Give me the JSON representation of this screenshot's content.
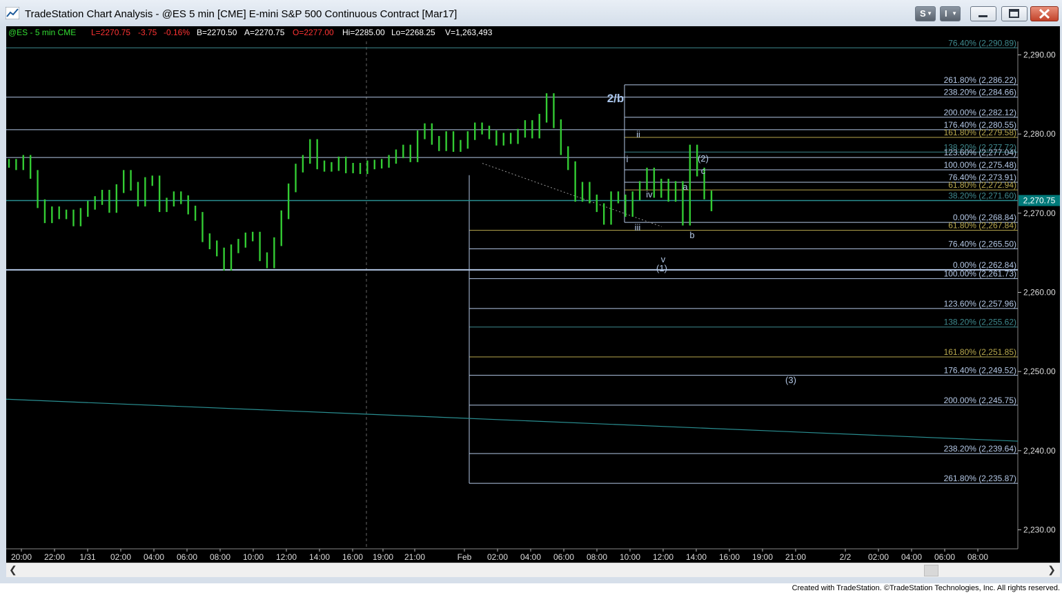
{
  "window": {
    "title": "TradeStation Chart Analysis - @ES 5 min [CME] E-mini S&P 500 Continuous Contract [Mar17]",
    "btn_s": "S",
    "btn_i": "I",
    "footer": "Created with TradeStation. ©TradeStation Technologies, Inc. All rights reserved."
  },
  "colors": {
    "background": "#000000",
    "bars": "#33cc33",
    "fib": "#b4c8e6",
    "fib_gold": "#b9a94e",
    "fib_teal": "#3f8a8f",
    "trend": "#2a8f92",
    "price_label_bg": "#007a7a"
  },
  "quote": {
    "symbol": "@ES - 5 min  CME",
    "last": "L=2270.75",
    "change": "-3.75",
    "pct": "-0.16%",
    "bid": "B=2270.50",
    "ask": "A=2270.75",
    "open": "O=2277.00",
    "high": "Hi=2285.00",
    "low": "Lo=2268.25",
    "volume": "V=1,263,493"
  },
  "chart_data": {
    "type": "line",
    "title": "@ES 5 min [CME] E-mini S&P 500 Continuous Contract [Mar17]",
    "series": [
      {
        "values": [
          2276.3,
          2276.0,
          2276.8,
          2274.9,
          2271.2,
          2269.3,
          2270.3,
          2269.8,
          2269.9,
          2268.9,
          2270.1,
          2271.0,
          2271.6,
          2272.4,
          2270.6,
          2273.1,
          2274.9,
          2273.4,
          2271.4,
          2274.0,
          2274.2,
          2270.7,
          2271.4,
          2272.2,
          2271.7,
          2270.4,
          2269.6,
          2266.9,
          2266.0,
          2265.1,
          2263.3,
          2265.5,
          2266.2,
          2267.0,
          2267.1,
          2264.5,
          2263.6,
          2266.4,
          2269.8,
          2273.2,
          2275.7,
          2276.8,
          2278.8,
          2276.1,
          2275.8,
          2275.9,
          2276.6,
          2275.6,
          2275.8,
          2275.5,
          2276.1,
          2276.2,
          2276.3,
          2276.8,
          2277.5,
          2278.1,
          2277.0,
          2279.9,
          2280.8,
          2279.2,
          2278.4,
          2279.8,
          2278.3,
          2278.7,
          2279.8,
          2280.9,
          2280.5,
          2279.9,
          2279.1,
          2279.6,
          2279.3,
          2280.1,
          2281.2,
          2280.0,
          2282.0,
          2284.6,
          2281.3,
          2277.9,
          2276.0,
          2272.0,
          2273.4,
          2271.8,
          2270.7,
          2269.1,
          2272.2,
          2271.8,
          2270.1,
          2272.2,
          2273.5,
          2275.2,
          2272.5,
          2273.8,
          2272.0,
          2273.5,
          2269.0,
          2278.1,
          2275.2,
          2272.3,
          2270.8
        ]
      }
    ],
    "x_ticks": [
      "20:00",
      "22:00",
      "1/31",
      "02:00",
      "04:00",
      "06:00",
      "08:00",
      "10:00",
      "12:00",
      "14:00",
      "16:00",
      "19:00",
      "21:00",
      "Feb",
      "02:00",
      "04:00",
      "06:00",
      "08:00",
      "10:00",
      "12:00",
      "14:00",
      "16:00",
      "19:00",
      "21:00",
      "2/2",
      "02:00",
      "04:00",
      "06:00",
      "08:00"
    ],
    "y_ticks": [
      "2,290.00",
      "2,280.00",
      "2,270.00",
      "2,260.00",
      "2,250.00",
      "2,240.00",
      "2,230.00"
    ],
    "ylim": [
      2227.6,
      2291.7
    ],
    "last_price": "2,270.75",
    "wave_labels": [
      "2/b",
      "ii",
      "i",
      "iv",
      "iii",
      "v",
      "(1)",
      "a",
      "b",
      "c",
      "(2)",
      "(3)"
    ],
    "fib_right": [
      {
        "label": "76.40% (2,290.89)",
        "price": 2290.89,
        "color": "teal"
      },
      {
        "label": "261.80% (2,286.22)",
        "price": 2286.22,
        "color": "light"
      },
      {
        "label": "238.20% (2,284.66)",
        "price": 2284.66,
        "color": "light"
      },
      {
        "label": "200.00% (2,282.12)",
        "price": 2282.12,
        "color": "light"
      },
      {
        "label": "176.40% (2,280.55)",
        "price": 2280.55,
        "color": "light"
      },
      {
        "label": "161.80% (2,279.58)",
        "price": 2279.58,
        "color": "gold"
      },
      {
        "label": "138.20% (2,277.72)",
        "price": 2277.72,
        "color": "teal"
      },
      {
        "label": "123.60% (2,277.04)",
        "price": 2277.04,
        "color": "light"
      },
      {
        "label": "100.00% (2,275.48)",
        "price": 2275.48,
        "color": "light"
      },
      {
        "label": "76.40% (2,273.91)",
        "price": 2273.91,
        "color": "light"
      },
      {
        "label": "61.80% (2,272.94)",
        "price": 2272.94,
        "color": "gold"
      },
      {
        "label": "38.20% (2,271.60)",
        "price": 2271.6,
        "color": "teal"
      },
      {
        "label": "0.00% (2,268.84)",
        "price": 2268.84,
        "color": "light"
      },
      {
        "label": "61.80% (2,267.84)",
        "price": 2267.84,
        "color": "gold"
      },
      {
        "label": "76.40% (2,265.50)",
        "price": 2265.5,
        "color": "light"
      },
      {
        "label": "0.00% (2,262.84)",
        "price": 2262.84,
        "color": "light"
      },
      {
        "label": "100.00% (2,261.73)",
        "price": 2261.73,
        "color": "light"
      },
      {
        "label": "123.60% (2,257.96)",
        "price": 2257.96,
        "color": "light"
      },
      {
        "label": "138.20% (2,255.62)",
        "price": 2255.62,
        "color": "teal"
      },
      {
        "label": "161.80% (2,251.85)",
        "price": 2251.85,
        "color": "gold"
      },
      {
        "label": "176.40% (2,249.52)",
        "price": 2249.52,
        "color": "light"
      },
      {
        "label": "200.00% (2,245.75)",
        "price": 2245.75,
        "color": "light"
      },
      {
        "label": "238.20% (2,239.64)",
        "price": 2239.64,
        "color": "light"
      },
      {
        "label": "261.80% (2,235.87)",
        "price": 2235.87,
        "color": "light"
      }
    ],
    "grid": false,
    "legend": "none"
  }
}
